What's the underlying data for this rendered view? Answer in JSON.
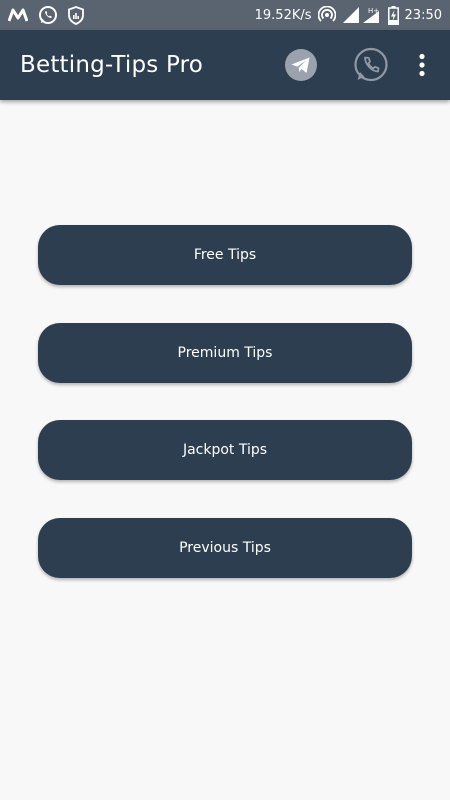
{
  "status_bar": {
    "icons": [
      "m-app-icon",
      "whatsapp-icon",
      "shield-icon"
    ],
    "network_speed": "19.52K/s",
    "network_type": "H+",
    "time": "23:50"
  },
  "app_bar": {
    "title": "Betting-Tips Pro",
    "actions": [
      "telegram-icon",
      "whatsapp-icon",
      "more-vert-icon"
    ]
  },
  "menu": {
    "free_tips": "Free Tips",
    "premium_tips": "Premium Tips",
    "jackpot_tips": "Jackpot Tips",
    "previous_tips": "Previous Tips"
  },
  "colors": {
    "primary": "#2d3e50",
    "status_bar": "#5a6470",
    "background": "#f8f8f8",
    "telegram_circle": "#9aa3ad"
  }
}
